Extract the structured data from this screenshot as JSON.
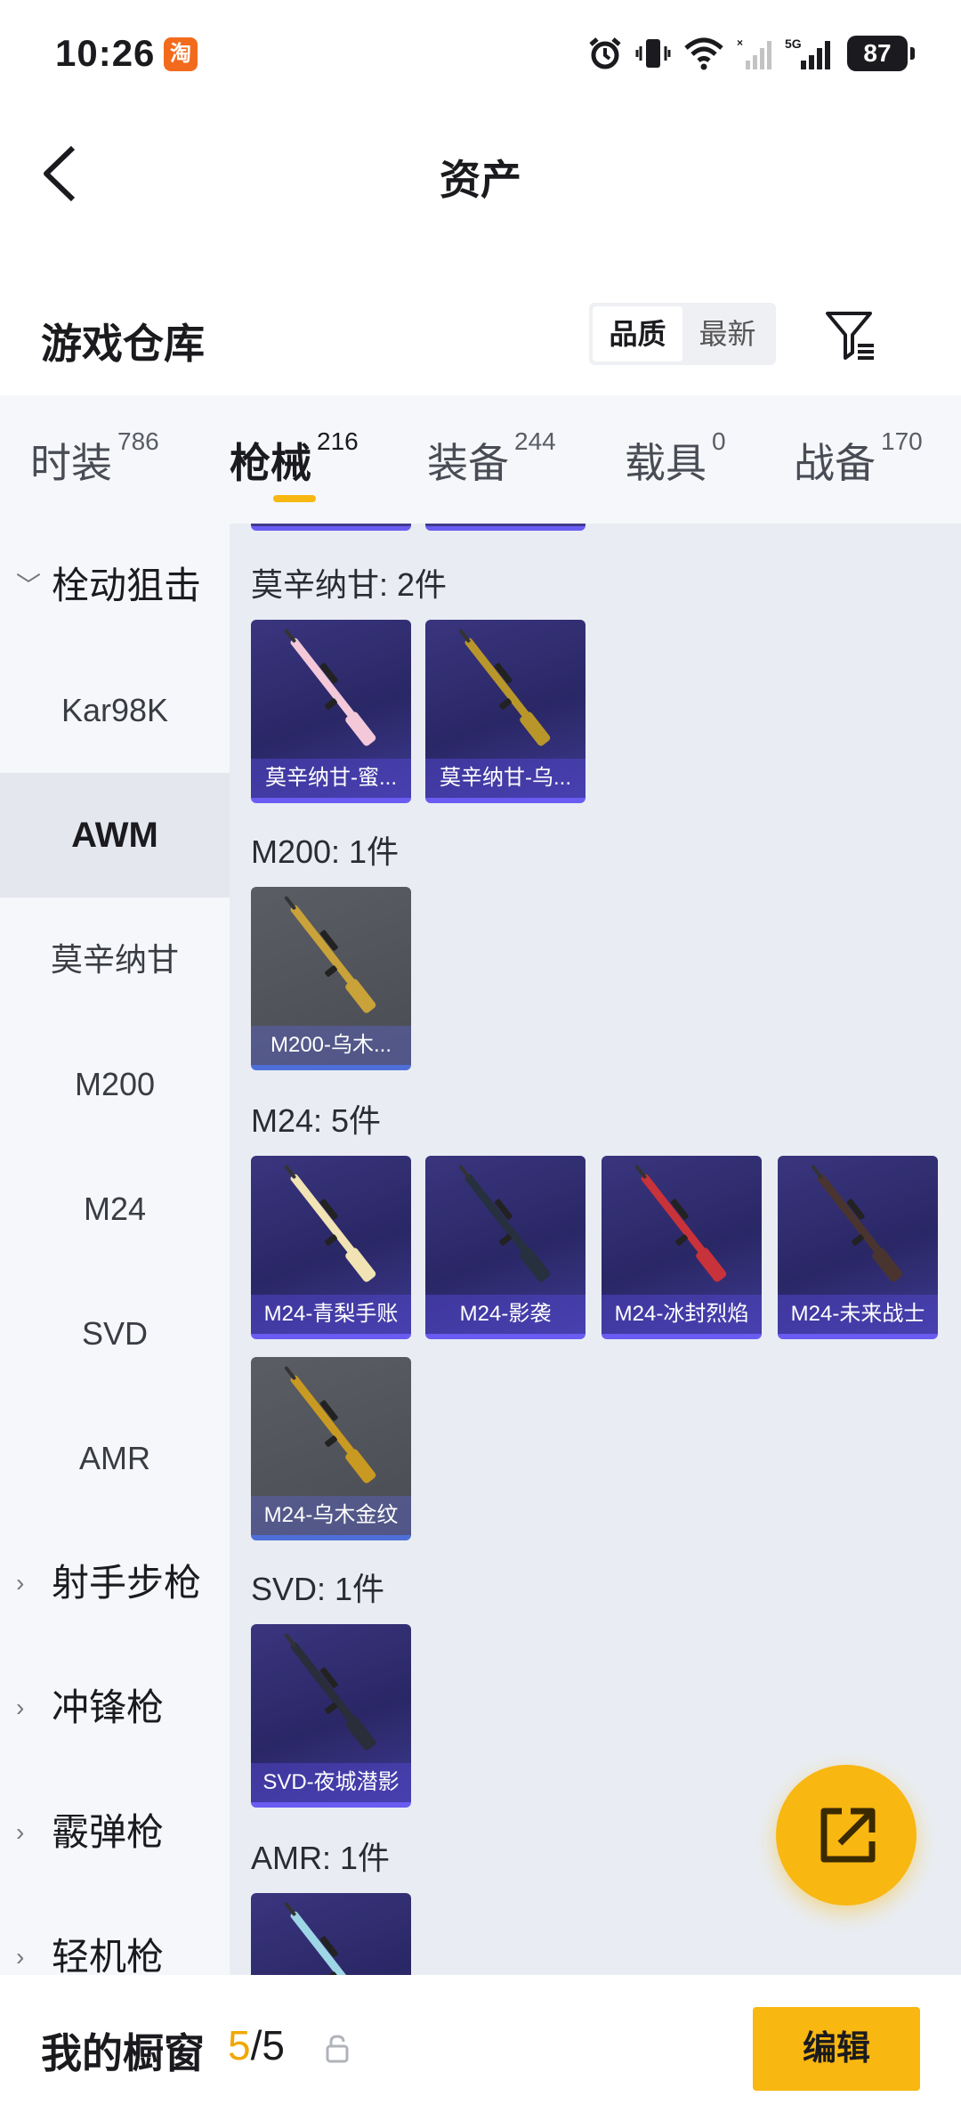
{
  "status_bar": {
    "time": "10:26",
    "app_badge": "淘",
    "battery": "87"
  },
  "nav": {
    "title": "资产"
  },
  "warehouse": {
    "title": "游戏仓库",
    "sort_options": [
      "品质",
      "最新"
    ],
    "sort_selected": "品质"
  },
  "category_tabs": [
    {
      "label": "时装",
      "count": "786"
    },
    {
      "label": "枪械",
      "count": "216",
      "active": true
    },
    {
      "label": "装备",
      "count": "244"
    },
    {
      "label": "载具",
      "count": "0"
    },
    {
      "label": "战备",
      "count": "170"
    }
  ],
  "side_list": [
    {
      "label": "栓动狙击",
      "type": "group",
      "expanded": true
    },
    {
      "label": "Kar98K"
    },
    {
      "label": "AWM",
      "selected": true
    },
    {
      "label": "莫辛纳甘"
    },
    {
      "label": "M200"
    },
    {
      "label": "M24"
    },
    {
      "label": "SVD"
    },
    {
      "label": "AMR"
    },
    {
      "label": "射手步枪",
      "type": "group"
    },
    {
      "label": "冲锋枪",
      "type": "group"
    },
    {
      "label": "霰弹枪",
      "type": "group"
    },
    {
      "label": "轻机枪",
      "type": "group"
    }
  ],
  "sections": [
    {
      "title": "莫辛纳甘: 2件",
      "items": [
        {
          "name": "莫辛纳甘-蜜...",
          "style": "purple",
          "gun_color": "#f3c8d8"
        },
        {
          "name": "莫辛纳甘-乌...",
          "style": "purple",
          "gun_color": "#b8962a"
        }
      ]
    },
    {
      "title": "M200: 1件",
      "items": [
        {
          "name": "M200-乌木...",
          "style": "gray",
          "gun_color": "#c9a23a"
        }
      ]
    },
    {
      "title": "M24: 5件",
      "items": [
        {
          "name": "M24-青梨手账",
          "style": "purple",
          "gun_color": "#f1e3b4"
        },
        {
          "name": "M24-影袭",
          "style": "purple",
          "gun_color": "#27303f"
        },
        {
          "name": "M24-冰封烈焰",
          "style": "purple",
          "gun_color": "#c8323a"
        },
        {
          "name": "M24-未来战士",
          "style": "purple",
          "gun_color": "#4a3430"
        },
        {
          "name": "M24-乌木金纹",
          "style": "gray",
          "gun_color": "#c99a22"
        }
      ]
    },
    {
      "title": "SVD: 1件",
      "items": [
        {
          "name": "SVD-夜城潜影",
          "style": "purple",
          "gun_color": "#2a2d3a"
        }
      ]
    },
    {
      "title": "AMR: 1件",
      "items": [
        {
          "name": "",
          "style": "purple",
          "gun_color": "#9fd6e6"
        }
      ]
    }
  ],
  "bottom_bar": {
    "label": "我的橱窗",
    "count_current": "5",
    "count_sep": "/",
    "count_total": "5",
    "edit_label": "编辑"
  },
  "colors": {
    "accent": "#f8b711",
    "panel_bg": "#e9edf3",
    "side_bg": "#f5f7fa"
  }
}
